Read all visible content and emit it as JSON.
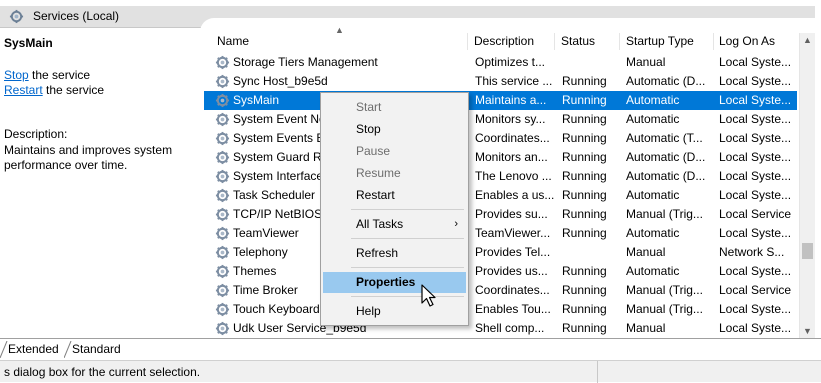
{
  "window": {
    "title": "Services (Local)"
  },
  "left_pane": {
    "service_name": "SysMain",
    "stop_link": "Stop",
    "stop_suffix": " the service",
    "restart_link": "Restart",
    "restart_suffix": " the service",
    "description_label": "Description:",
    "description_line1": "Maintains and improves system",
    "description_line2": "performance over time."
  },
  "columns": [
    "Name",
    "Description",
    "Status",
    "Startup Type",
    "Log On As"
  ],
  "rows": [
    {
      "name": "Storage Tiers Management",
      "description": "Optimizes t...",
      "status": "",
      "startup": "Manual",
      "logon": "Local Syste..."
    },
    {
      "name": "Sync Host_b9e5d",
      "description": "This service ...",
      "status": "Running",
      "startup": "Automatic (D...",
      "logon": "Local Syste..."
    },
    {
      "name": "SysMain",
      "description": "Maintains a...",
      "status": "Running",
      "startup": "Automatic",
      "logon": "Local Syste...",
      "selected": true
    },
    {
      "name": "System Event No",
      "description": "Monitors sy...",
      "status": "Running",
      "startup": "Automatic",
      "logon": "Local Syste..."
    },
    {
      "name": "System Events Br",
      "description": "Coordinates...",
      "status": "Running",
      "startup": "Automatic (T...",
      "logon": "Local Syste..."
    },
    {
      "name": "System Guard Ru",
      "description": "Monitors an...",
      "status": "Running",
      "startup": "Automatic (D...",
      "logon": "Local Syste..."
    },
    {
      "name": "System Interface",
      "description": "The Lenovo ...",
      "status": "Running",
      "startup": "Automatic (D...",
      "logon": "Local Syste..."
    },
    {
      "name": "Task Scheduler",
      "description": "Enables a us...",
      "status": "Running",
      "startup": "Automatic",
      "logon": "Local Syste..."
    },
    {
      "name": "TCP/IP NetBIOS H",
      "description": "Provides su...",
      "status": "Running",
      "startup": "Manual (Trig...",
      "logon": "Local Service"
    },
    {
      "name": "TeamViewer",
      "description": "TeamViewer...",
      "status": "Running",
      "startup": "Automatic",
      "logon": "Local Syste..."
    },
    {
      "name": "Telephony",
      "description": "Provides Tel...",
      "status": "",
      "startup": "Manual",
      "logon": "Network S..."
    },
    {
      "name": "Themes",
      "description": "Provides us...",
      "status": "Running",
      "startup": "Automatic",
      "logon": "Local Syste..."
    },
    {
      "name": "Time Broker",
      "description": "Coordinates...",
      "status": "Running",
      "startup": "Manual (Trig...",
      "logon": "Local Service"
    },
    {
      "name": "Touch Keyboard",
      "description": "Enables Tou...",
      "status": "Running",
      "startup": "Manual (Trig...",
      "logon": "Local Syste..."
    },
    {
      "name": "Udk User Service_b9e5d",
      "description": "Shell comp...",
      "status": "Running",
      "startup": "Manual",
      "logon": "Local Syste..."
    }
  ],
  "context_menu": {
    "start": "Start",
    "stop": "Stop",
    "pause": "Pause",
    "resume": "Resume",
    "restart": "Restart",
    "all_tasks": "All Tasks",
    "refresh": "Refresh",
    "properties": "Properties",
    "help": "Help"
  },
  "tabs": [
    "Extended",
    "Standard"
  ],
  "status_bar": {
    "text": "s dialog box for the current selection."
  },
  "icons": {
    "title": "services-icon",
    "row": "gear-icon",
    "cursor": "mouse-pointer-icon"
  },
  "colors": {
    "selection": "#0078d7",
    "menu_highlight": "#99c9ef",
    "link": "#0066cc"
  }
}
